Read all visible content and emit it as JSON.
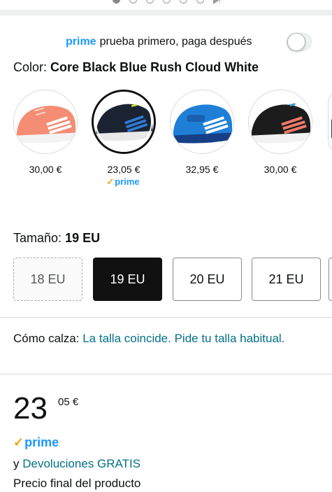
{
  "carousel": {
    "dot_count": 6,
    "active_index": 0
  },
  "prime_try": {
    "prime_word": "prime",
    "text": "prueba primero, paga después",
    "toggle_on": false
  },
  "color": {
    "label": "Color:",
    "selected": "Core Black Blue Rush Cloud White",
    "swatches": [
      {
        "price": "30,00 €",
        "main_color": "#f58c74",
        "stripe_color": "#ffffff",
        "selected": false
      },
      {
        "price": "23,05 €",
        "main_color": "#1b2333",
        "stripe_color": "#2f7bd8",
        "selected": true,
        "prime_label": "prime"
      },
      {
        "price": "32,95 €",
        "main_color": "#1f7fd6",
        "stripe_color": "#ffffff",
        "selected": false
      },
      {
        "price": "30,00 €",
        "main_color": "#1c1c1c",
        "stripe_color": "#f07a6a",
        "selected": false
      }
    ]
  },
  "size": {
    "label": "Tamaño:",
    "selected": "19 EU",
    "options": [
      {
        "label": "18 EU",
        "state": "unavailable"
      },
      {
        "label": "19 EU",
        "state": "selected"
      },
      {
        "label": "20 EU",
        "state": "available"
      },
      {
        "label": "21 EU",
        "state": "available"
      }
    ]
  },
  "fit": {
    "label": "Cómo calza:",
    "link_text": "La talla coincide. Pide tu talla habitual."
  },
  "price": {
    "whole": "23",
    "fraction": "05 €"
  },
  "prime_badge": "prime",
  "returns": {
    "prefix": "y",
    "link_text": "Devoluciones GRATIS"
  },
  "final_price_text": "Precio final del producto",
  "colors": {
    "prime_blue": "#1a98ff",
    "prime_check": "#f7a10f",
    "link_teal": "#007185",
    "text": "#0f1111"
  }
}
